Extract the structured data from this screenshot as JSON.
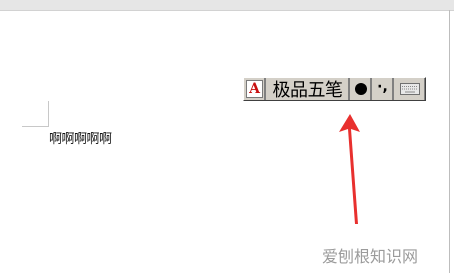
{
  "document": {
    "text": "啊啊啊啊啊"
  },
  "ime_toolbar": {
    "logo_glyph": "A",
    "logo_color": "#c81010",
    "input_method_name": "极品五笔",
    "mode_icon": "filled-circle-icon",
    "punctuation_glyph": "·,",
    "keyboard_icon": "soft-keyboard-icon"
  },
  "annotation": {
    "arrow_color": "#e8302e"
  },
  "watermark": {
    "text": "爱刨根知识网"
  }
}
